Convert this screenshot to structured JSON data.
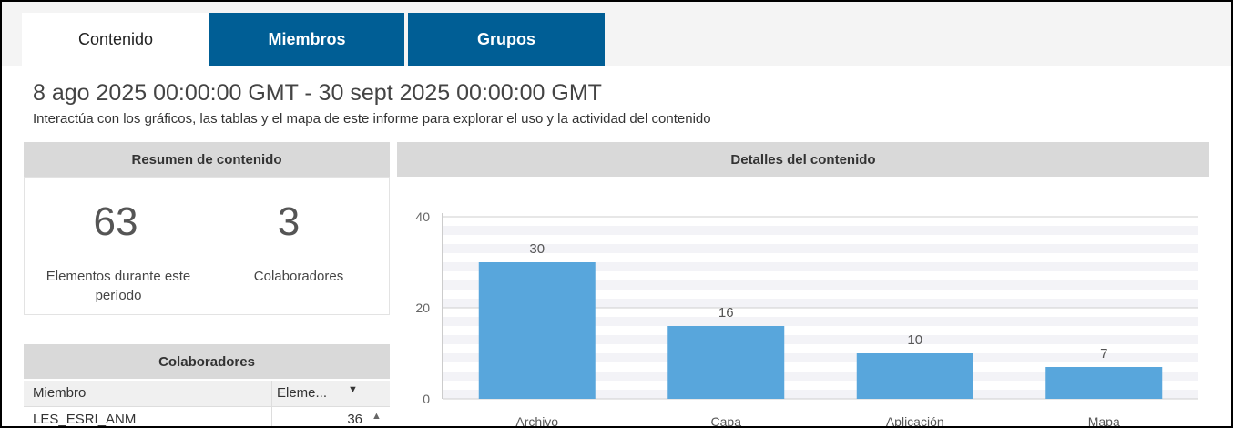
{
  "tabs": [
    {
      "label": "Contenido",
      "active": true
    },
    {
      "label": "Miembros",
      "active": false
    },
    {
      "label": "Grupos",
      "active": false
    }
  ],
  "header": {
    "date_range": "8 ago 2025 00:00:00 GMT - 30 sept 2025 00:00:00 GMT",
    "subtitle": "Interactúa con los gráficos, las tablas y el mapa de este informe para explorar el uso y la actividad del contenido"
  },
  "summary": {
    "title": "Resumen de contenido",
    "items_count": "63",
    "items_label": "Elementos durante este período",
    "contributors_count": "3",
    "contributors_label": "Colaboradores"
  },
  "contributors_table": {
    "title": "Colaboradores",
    "col_member": "Miembro",
    "col_items": "Eleme...",
    "rows": [
      {
        "member": "LES_ESRI_ANM",
        "items": "36"
      }
    ]
  },
  "details": {
    "title": "Detalles del contenido"
  },
  "colors": {
    "tab_blue": "#005e95",
    "bar": "#58a6dc",
    "header_gray": "#d9d9d9"
  },
  "chart_data": {
    "type": "bar",
    "categories": [
      "Archivo",
      "Capa",
      "Aplicación",
      "Mapa"
    ],
    "values": [
      30,
      16,
      10,
      7
    ],
    "ylim": [
      0,
      40
    ],
    "yticks": [
      0,
      20,
      40
    ],
    "grid": true
  }
}
